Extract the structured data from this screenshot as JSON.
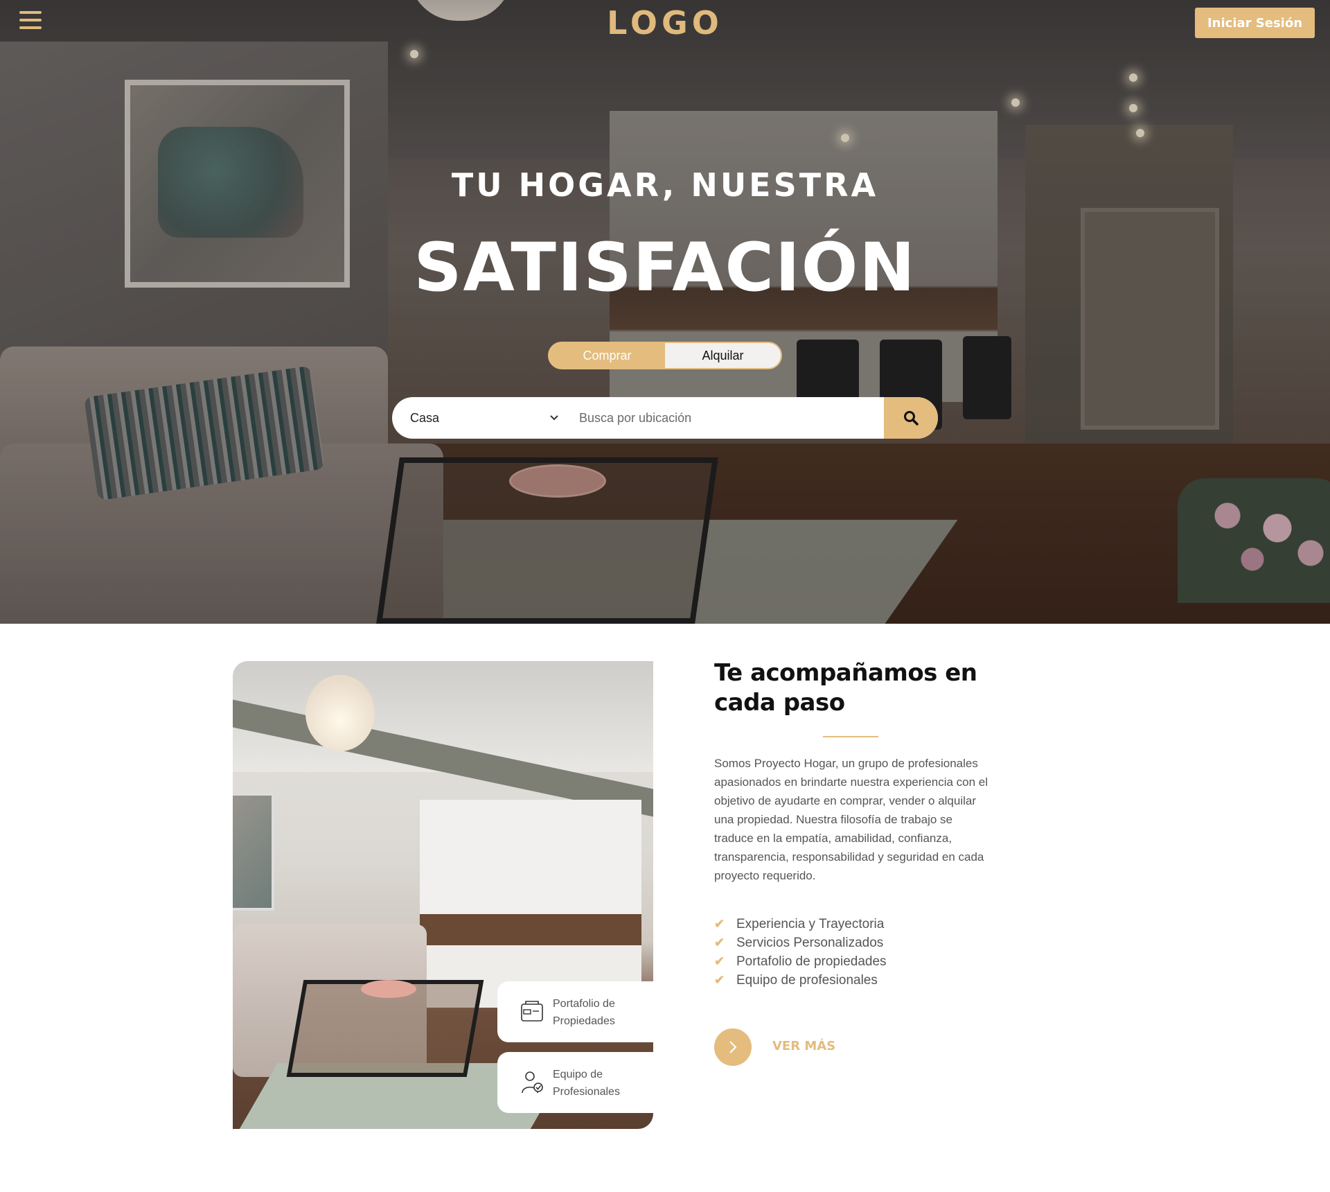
{
  "header": {
    "logo": "LOGO",
    "menu_icon": "hamburger-icon",
    "login_label": "Iniciar Sesión"
  },
  "hero": {
    "subtitle": "TU HOGAR, NUESTRA",
    "title": "SATISFACIÓN",
    "tabs": [
      {
        "label": "Comprar",
        "active": true
      },
      {
        "label": "Alquilar",
        "active": false
      }
    ],
    "search": {
      "type_value": "Casa",
      "location_placeholder": "Busca por ubicación",
      "search_icon": "search-icon"
    }
  },
  "features": {
    "cards": [
      {
        "label": "Portafolio de Propiedades",
        "line1": "Portafolio de",
        "line2": "Propiedades",
        "icon": "portfolio-icon"
      },
      {
        "label": "Equipo de Profesionales",
        "line1": "Equipo de",
        "line2": "Profesionales",
        "icon": "professional-icon"
      }
    ]
  },
  "about": {
    "heading_line1": "Te acompañamos en",
    "heading_line2": "cada paso",
    "body": "Somos Proyecto Hogar, un grupo de profesionales apasionados en brindarte nuestra experiencia con el objetivo de ayudarte en comprar, vender o alquilar una propiedad. Nuestra filosofía de trabajo se traduce en la empatía, amabilidad, confianza, transparencia, responsabilidad y seguridad en cada proyecto requerido.",
    "list": [
      "Experiencia y Trayectoria",
      "Servicios Personalizados",
      "Portafolio de propiedades",
      "Equipo de profesionales"
    ],
    "more_label": "VER MÁS"
  },
  "colors": {
    "accent": "#e3bc7e",
    "heading": "#111111",
    "body_text": "#555555"
  }
}
